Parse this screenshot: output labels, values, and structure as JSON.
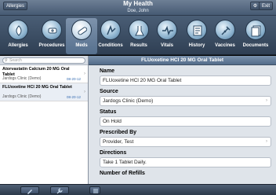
{
  "header": {
    "title": "My Health",
    "user": "Doe, John",
    "home_label": "Allergies",
    "exit_label": "Exit"
  },
  "categories": [
    {
      "label": "Allergies",
      "icon": "allergies-icon"
    },
    {
      "label": "Procedures",
      "icon": "procedures-icon"
    },
    {
      "label": "Meds",
      "icon": "meds-icon"
    },
    {
      "label": "Conditions",
      "icon": "conditions-icon"
    },
    {
      "label": "Results",
      "icon": "results-icon"
    },
    {
      "label": "Vitals",
      "icon": "vitals-icon"
    },
    {
      "label": "History",
      "icon": "history-icon"
    },
    {
      "label": "Vaccines",
      "icon": "vaccines-icon"
    },
    {
      "label": "Documents",
      "icon": "documents-icon"
    }
  ],
  "search": {
    "placeholder": "Search"
  },
  "list": [
    {
      "name": "Atorvastatin Calcium 20 MG Oral Tablet",
      "clinic": "Jardogs Clinic (Demo)",
      "date": "08-20-12"
    },
    {
      "name": "FLUoxetine HCl 20 MG Oral Tablet",
      "clinic": "Jardogs Clinic (Demo)",
      "date": "08-20-12"
    }
  ],
  "detail": {
    "title": "FLUoxetine HCl 20 MG Oral Tablet",
    "name_label": "Name",
    "name_value": "FLUoxetine HCl 20 MG Oral Tablet",
    "source_label": "Source",
    "source_value": "Jardogs Clinic (Demo)",
    "status_label": "Status",
    "status_value": "On Hold",
    "prescribed_label": "Prescribed By",
    "prescribed_value": "Provider, Test",
    "directions_label": "Directions",
    "directions_value": "Take 1 Tablet Daily.",
    "refills_label": "Number of Refills"
  },
  "colors": {
    "accent": "#536c8a",
    "date": "#3a6fb3"
  }
}
